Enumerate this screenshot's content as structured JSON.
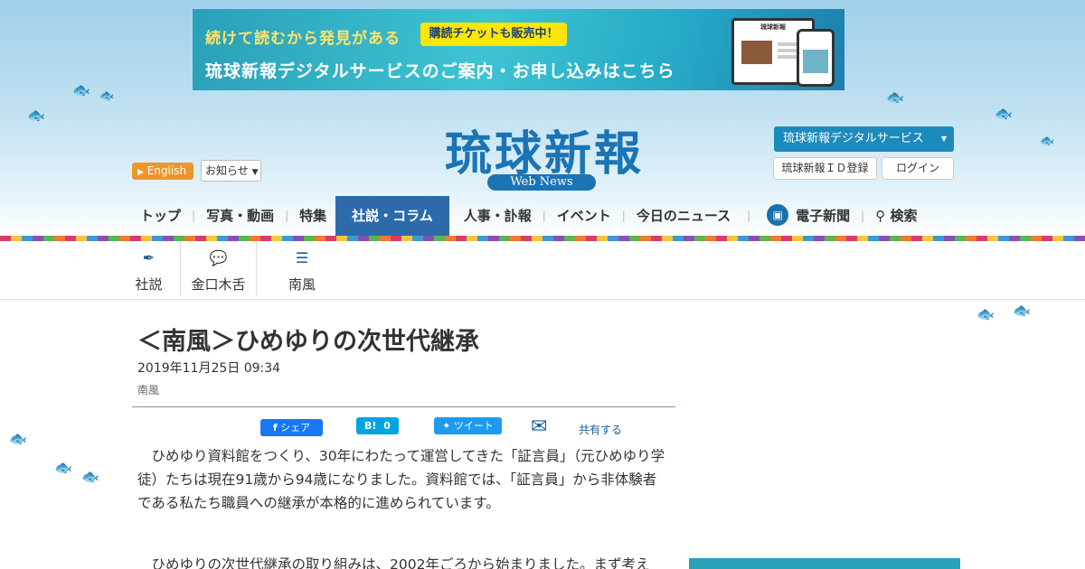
{
  "banner": {
    "line1": "続けて読むから発見がある",
    "pill": "購読チケットも販売中！",
    "line2": "琉球新報デジタルサービスのご案内・お申し込みはこちら",
    "device_title": "琉球新報"
  },
  "header": {
    "logo_title": "琉球新報",
    "logo_sub": "Web News",
    "english_label": "English",
    "notice_label": "お知らせ",
    "digital_service_label": "琉球新報デジタルサービス",
    "id_register_label": "琉球新報ＩＤ登録",
    "login_label": "ログイン"
  },
  "nav": {
    "items": [
      {
        "label": "トップ"
      },
      {
        "label": "写真・動画"
      },
      {
        "label": "特集"
      },
      {
        "label": "社説・コラム",
        "active": true
      },
      {
        "label": "人事・訃報"
      },
      {
        "label": "イベント"
      },
      {
        "label": "今日のニュース"
      },
      {
        "label": "電子新聞"
      },
      {
        "label": "検索"
      }
    ]
  },
  "subnav": {
    "items": [
      {
        "label": "社説",
        "icon": "pen-icon"
      },
      {
        "label": "金口木舌",
        "icon": "speech-bubble-icon"
      },
      {
        "label": "南風",
        "icon": "comment-icon"
      }
    ]
  },
  "article": {
    "title": "＜南風＞ひめゆりの次世代継承",
    "date": "2019年11月25日 09:34",
    "category": "南風",
    "share": {
      "facebook": "シェア",
      "hatena_count": "0",
      "twitter": "ツイート",
      "more": "共有する"
    },
    "paragraphs": [
      "ひめゆり資料館をつくり、30年にわたって運営してきた「証言員」（元ひめゆり学徒）たちは現在91歳から94歳になりました。資料館では、「証言員」から非体験者である私たち職員への継承が本格的に進められています。",
      "ひめゆりの次世代継承の取り組みは、2002年ごろから始まりました。まず考え"
    ]
  },
  "colors": {
    "brand_blue": "#1a74b5",
    "nav_active": "#2d6aaa",
    "english_orange": "#f0952b"
  }
}
